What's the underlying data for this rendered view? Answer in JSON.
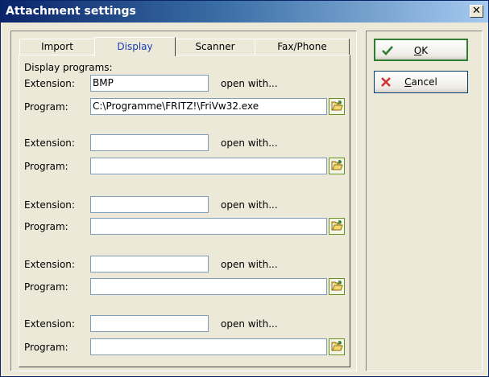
{
  "window": {
    "title": "Attachment settings"
  },
  "tabs": [
    {
      "label": "Import"
    },
    {
      "label": "Display"
    },
    {
      "label": "Scanner"
    },
    {
      "label": "Fax/Phone"
    }
  ],
  "section_label": "Display programs:",
  "rows": [
    {
      "extension_label": "Extension:",
      "extension_value": "BMP",
      "open_with": "open with...",
      "program_label": "Program:",
      "program_value": "C:\\Programme\\FRITZ!\\FriVw32.exe"
    },
    {
      "extension_label": "Extension:",
      "extension_value": "",
      "open_with": "open with...",
      "program_label": "Program:",
      "program_value": ""
    },
    {
      "extension_label": "Extension:",
      "extension_value": "",
      "open_with": "open with...",
      "program_label": "Program:",
      "program_value": ""
    },
    {
      "extension_label": "Extension:",
      "extension_value": "",
      "open_with": "open with...",
      "program_label": "Program:",
      "program_value": ""
    },
    {
      "extension_label": "Extension:",
      "extension_value": "",
      "open_with": "open with...",
      "program_label": "Program:",
      "program_value": ""
    }
  ],
  "buttons": {
    "ok": {
      "label": "OK",
      "icon": "checkmark-icon",
      "color": "#2E7D32"
    },
    "cancel": {
      "label": "Cancel",
      "icon": "red-x-icon",
      "color": "#D32F2F"
    }
  },
  "colors": {
    "title_start": "#0A246A",
    "title_end": "#A6CAF0",
    "active_tab_text": "#1A3CB8",
    "face": "#ECE9D8"
  }
}
